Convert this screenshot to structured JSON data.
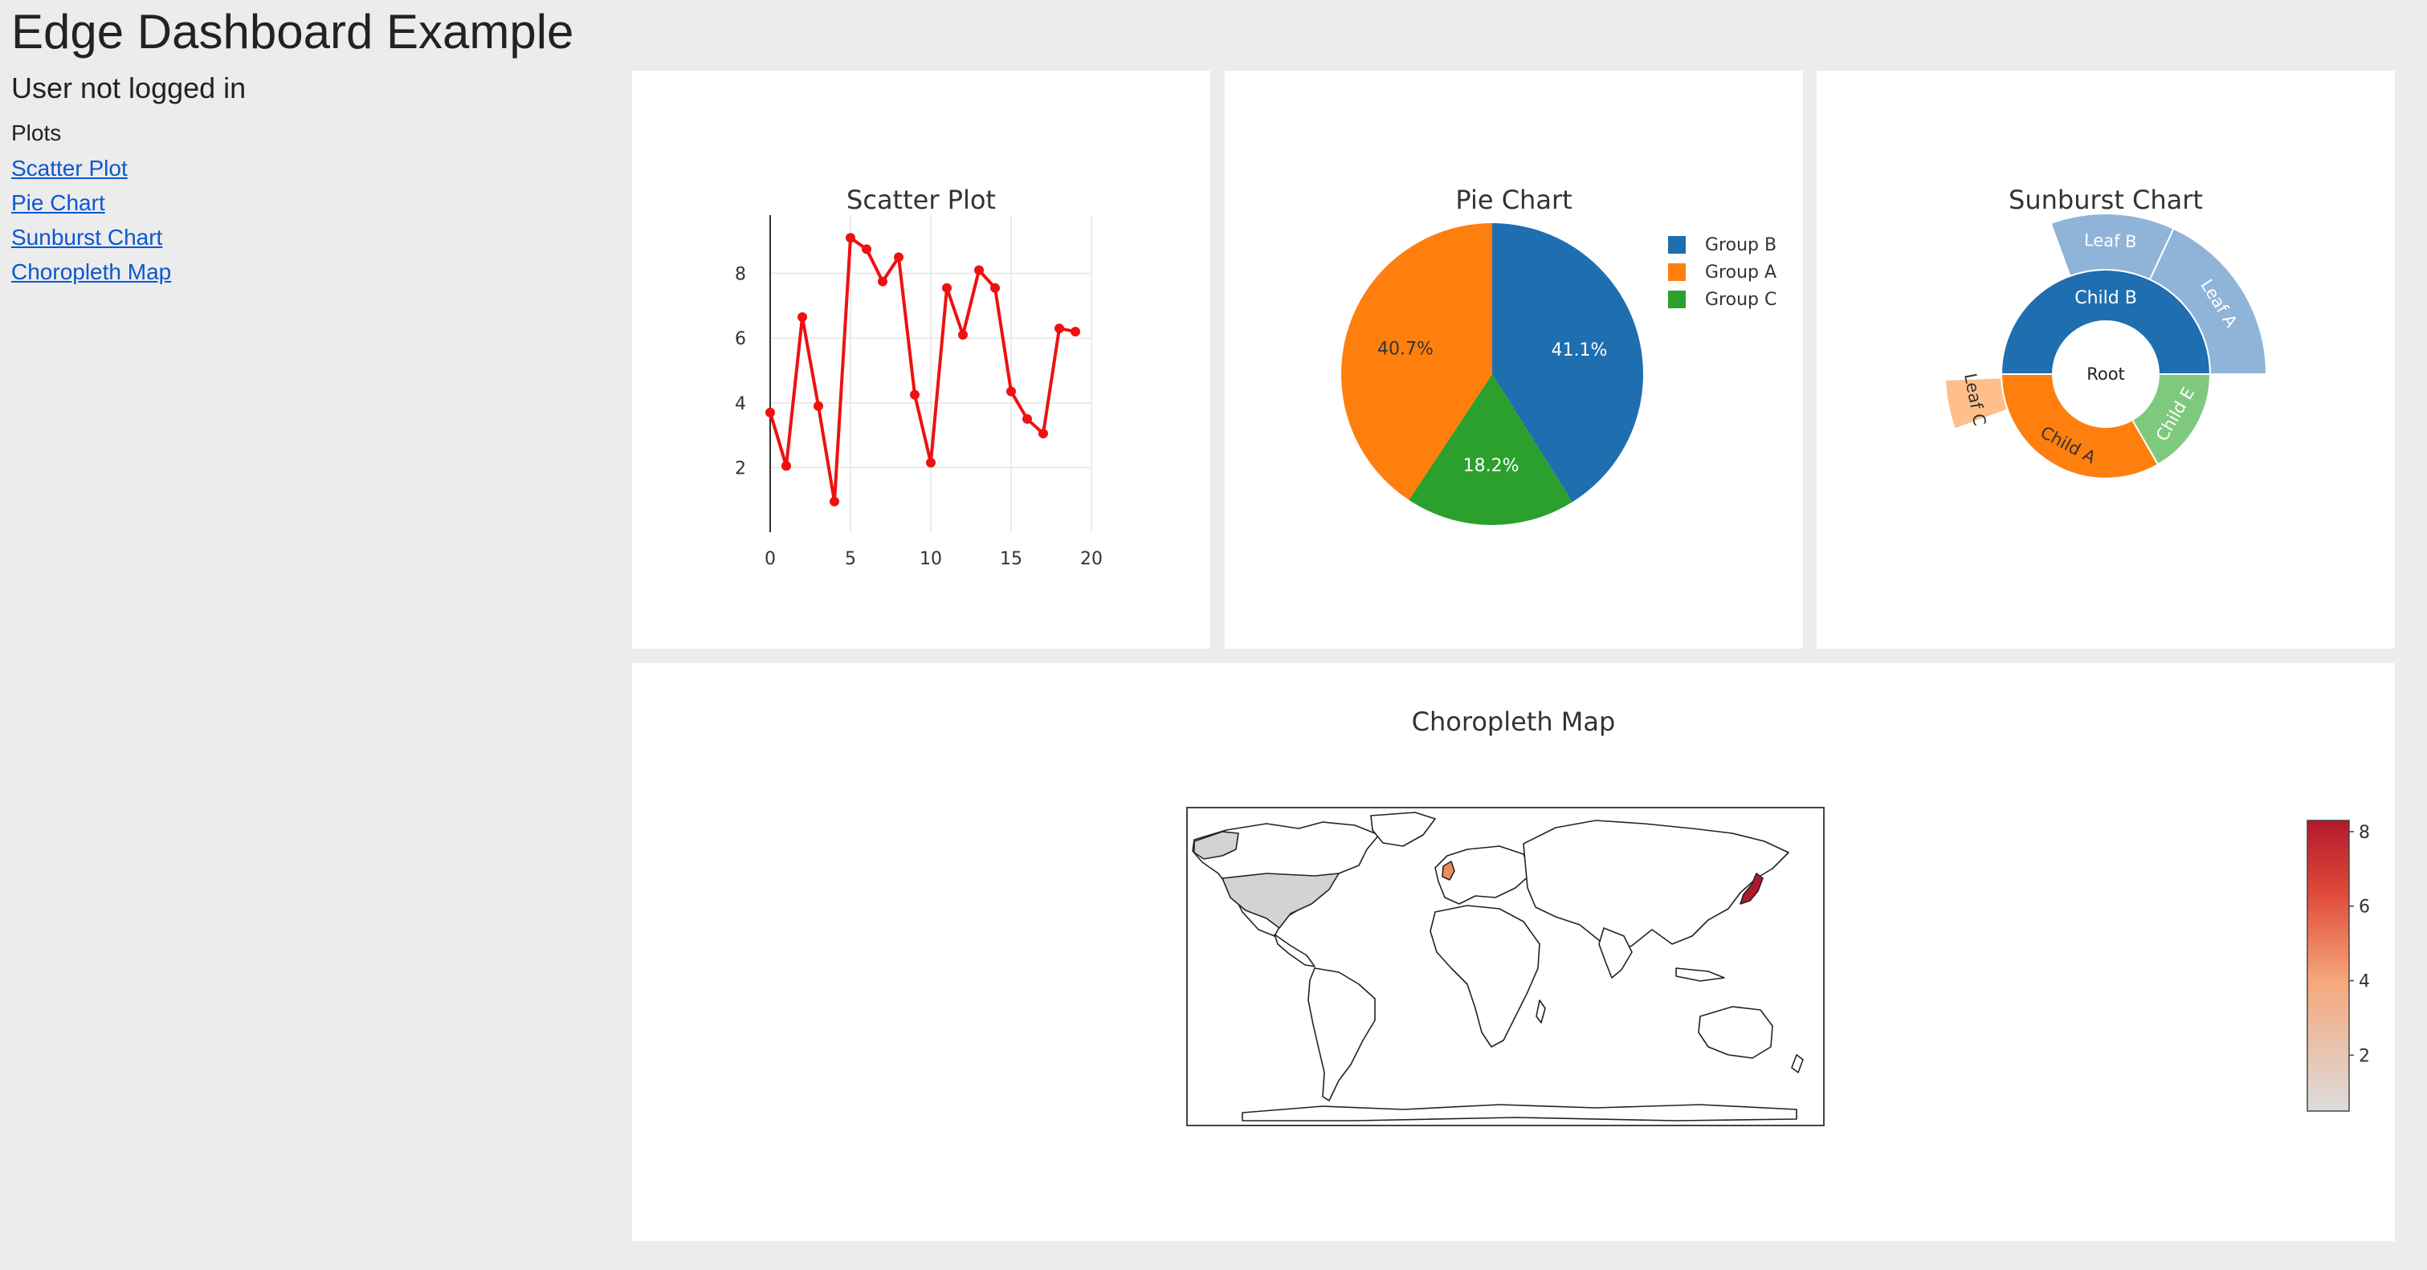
{
  "header": {
    "title": "Edge Dashboard Example",
    "user_status": "User not logged in"
  },
  "nav": {
    "heading": "Plots",
    "links": [
      "Scatter Plot",
      "Pie Chart",
      "Sunburst Chart",
      "Choropleth Map"
    ]
  },
  "colors": {
    "page_bg": "#ececec",
    "panel_bg": "#ffffff",
    "link": "#0b57d0",
    "scatter_line": "#ee1111"
  },
  "panels": {
    "scatter": {
      "title": "Scatter Plot"
    },
    "pie": {
      "title": "Pie Chart"
    },
    "sunburst": {
      "title": "Sunburst Chart"
    },
    "choropleth": {
      "title": "Choropleth Map"
    }
  },
  "chart_data": [
    {
      "type": "line",
      "title": "Scatter Plot",
      "x": [
        0,
        1,
        2,
        3,
        4,
        5,
        6,
        7,
        8,
        9,
        10,
        11,
        12,
        13,
        14,
        15,
        16,
        17,
        18,
        19
      ],
      "y": [
        3.7,
        2.05,
        6.65,
        3.9,
        0.95,
        9.1,
        8.75,
        7.75,
        8.5,
        4.25,
        2.15,
        7.55,
        6.1,
        8.1,
        7.55,
        4.35,
        3.5,
        3.05,
        6.3,
        6.2
      ],
      "xlim": [
        0,
        20
      ],
      "ylim": [
        0,
        9.8
      ],
      "xticks": [
        0,
        5,
        10,
        15,
        20
      ],
      "yticks": [
        2,
        4,
        6,
        8
      ],
      "grid": true,
      "color": "#ee1111"
    },
    {
      "type": "pie",
      "title": "Pie Chart",
      "slices": [
        {
          "label": "Group B",
          "value": 41.1,
          "text": "41.1%",
          "color": "#1f6eb0"
        },
        {
          "label": "Group C",
          "value": 18.2,
          "text": "18.2%",
          "color": "#2ca02c"
        },
        {
          "label": "Group A",
          "value": 40.7,
          "text": "40.7%",
          "color": "#ff7f0e"
        }
      ],
      "legend": [
        "Group B",
        "Group A",
        "Group C"
      ],
      "legend_position": "top-right"
    },
    {
      "type": "sunburst",
      "title": "Sunburst Chart",
      "root": "Root",
      "children": [
        {
          "label": "Child B",
          "color": "#1f6eb0",
          "leaves": [
            {
              "label": "Leaf B",
              "color": "#8fb4d8"
            },
            {
              "label": "Leaf A",
              "color": "#8fb4d8"
            }
          ]
        },
        {
          "label": "Child E",
          "color": "#7fc97f",
          "leaves": []
        },
        {
          "label": "Child A",
          "color": "#ff7f0e",
          "leaves": [
            {
              "label": "Leaf C",
              "color": "#ffbf8a"
            }
          ]
        }
      ]
    },
    {
      "type": "choropleth",
      "title": "Choropleth Map",
      "colorbar": {
        "min": 0.5,
        "max": 8.3,
        "ticks": [
          2,
          4,
          6,
          8
        ],
        "colorscale": [
          "#dcdcdc",
          "#f5a77a",
          "#e04a3a",
          "#b2182b"
        ]
      },
      "regions": [
        {
          "name": "United States",
          "value": 0.5
        },
        {
          "name": "United Kingdom",
          "value": 4
        },
        {
          "name": "Japan",
          "value": 8
        }
      ]
    }
  ]
}
